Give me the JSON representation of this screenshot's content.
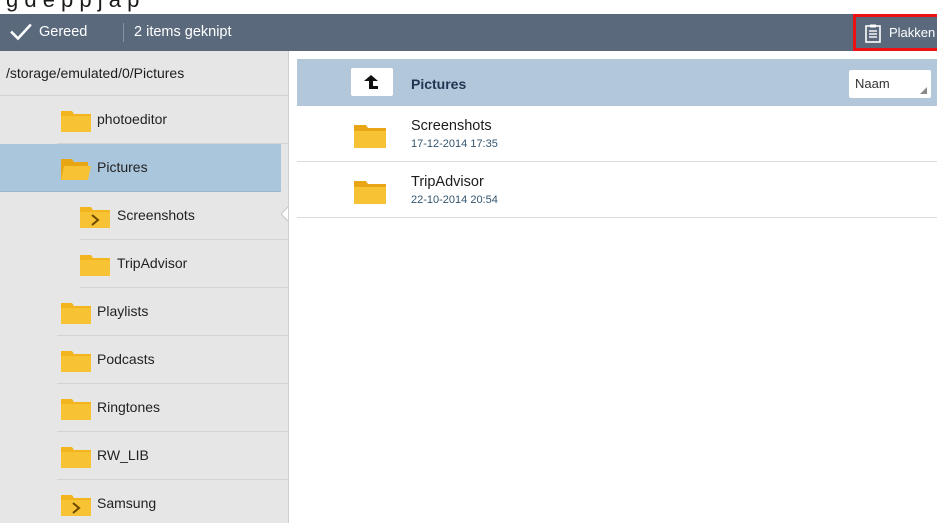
{
  "top_band": {
    "text": "g  d    e         p                          p                   j    a      p"
  },
  "action_bar": {
    "done_label": "Gereed",
    "clipboard_status": "2 items geknipt",
    "paste_label": "Plakken",
    "colors": {
      "bar": "#5a6a7c",
      "highlight_border": "#ee1111"
    }
  },
  "tree": {
    "path": "/storage/emulated/0/Pictures",
    "items": [
      {
        "label": "photoeditor",
        "icon": "folder-icon",
        "level": 1,
        "selected": false
      },
      {
        "label": "Pictures",
        "icon": "folder-open-icon",
        "level": 1,
        "selected": true
      },
      {
        "label": "Screenshots",
        "icon": "folder-expand-icon",
        "level": 2,
        "selected": false
      },
      {
        "label": "TripAdvisor",
        "icon": "folder-icon",
        "level": 2,
        "selected": false
      },
      {
        "label": "Playlists",
        "icon": "folder-icon",
        "level": 1,
        "selected": false
      },
      {
        "label": "Podcasts",
        "icon": "folder-icon",
        "level": 1,
        "selected": false
      },
      {
        "label": "Ringtones",
        "icon": "folder-icon",
        "level": 1,
        "selected": false
      },
      {
        "label": "RW_LIB",
        "icon": "folder-icon",
        "level": 1,
        "selected": false
      },
      {
        "label": "Samsung",
        "icon": "folder-expand-icon",
        "level": 1,
        "selected": false
      }
    ],
    "colors": {
      "selected": "#aac6dc",
      "panel": "#e6e6e6"
    }
  },
  "content": {
    "current_folder": "Pictures",
    "sort": {
      "selected": "Naam"
    },
    "files": [
      {
        "name": "Screenshots",
        "date": "17-12-2014 17:35",
        "icon": "folder-icon"
      },
      {
        "name": "TripAdvisor",
        "date": "22-10-2014 20:54",
        "icon": "folder-icon"
      }
    ],
    "colors": {
      "header": "#b3c7db",
      "folder": "#f2b51d"
    }
  }
}
